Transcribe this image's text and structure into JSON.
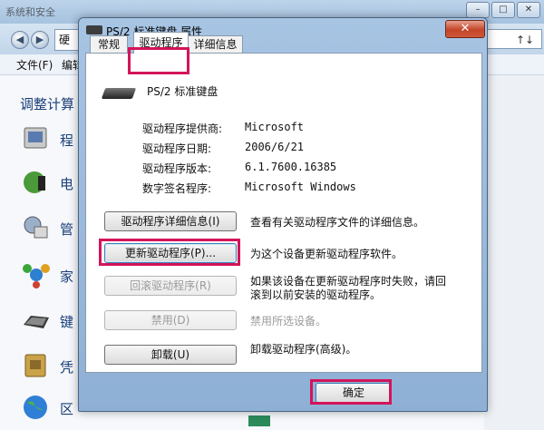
{
  "background_window": {
    "title": "系统和安全",
    "window_buttons": [
      "–",
      "□",
      "✕"
    ],
    "address_fragment": "硬",
    "address_right_icon": "↑↓",
    "menu": [
      "文件(F)",
      "编辑"
    ],
    "heading": "调整计算",
    "items": [
      {
        "label": "程",
        "icon": "programs-icon"
      },
      {
        "label": "电",
        "icon": "power-icon"
      },
      {
        "label": "管",
        "icon": "admin-tools-icon"
      },
      {
        "label": "家",
        "icon": "homegroup-icon"
      },
      {
        "label": "键",
        "icon": "keyboard-icon"
      },
      {
        "label": "凭",
        "icon": "credential-icon"
      },
      {
        "label": "区",
        "icon": "region-icon"
      }
    ]
  },
  "dialog": {
    "title": "PS/2 标准键盘 属性",
    "close_symbol": "✕",
    "tabs": [
      {
        "label": "常规"
      },
      {
        "label": "驱动程序"
      },
      {
        "label": "详细信息"
      }
    ],
    "device_name": "PS/2 标准键盘",
    "info": [
      {
        "label": "驱动程序提供商:",
        "value": "Microsoft"
      },
      {
        "label": "驱动程序日期:",
        "value": "2006/6/21"
      },
      {
        "label": "驱动程序版本:",
        "value": "6.1.7600.16385"
      },
      {
        "label": "数字签名程序:",
        "value": "Microsoft Windows"
      }
    ],
    "actions": [
      {
        "button": "驱动程序详细信息(I)",
        "desc": "查看有关驱动程序文件的详细信息。",
        "enabled": true
      },
      {
        "button": "更新驱动程序(P)...",
        "desc": "为这个设备更新驱动程序软件。",
        "enabled": true
      },
      {
        "button": "回滚驱动程序(R)",
        "desc": "如果该设备在更新驱动程序时失败，请回",
        "desc2": "滚到以前安装的驱动程序。",
        "enabled": false
      },
      {
        "button": "禁用(D)",
        "desc": "禁用所选设备。",
        "enabled": false
      },
      {
        "button": "卸载(U)",
        "desc": "卸载驱动程序(高级)。",
        "enabled": true
      }
    ],
    "ok_label": "确定"
  },
  "highlight_color": "#d4145a"
}
